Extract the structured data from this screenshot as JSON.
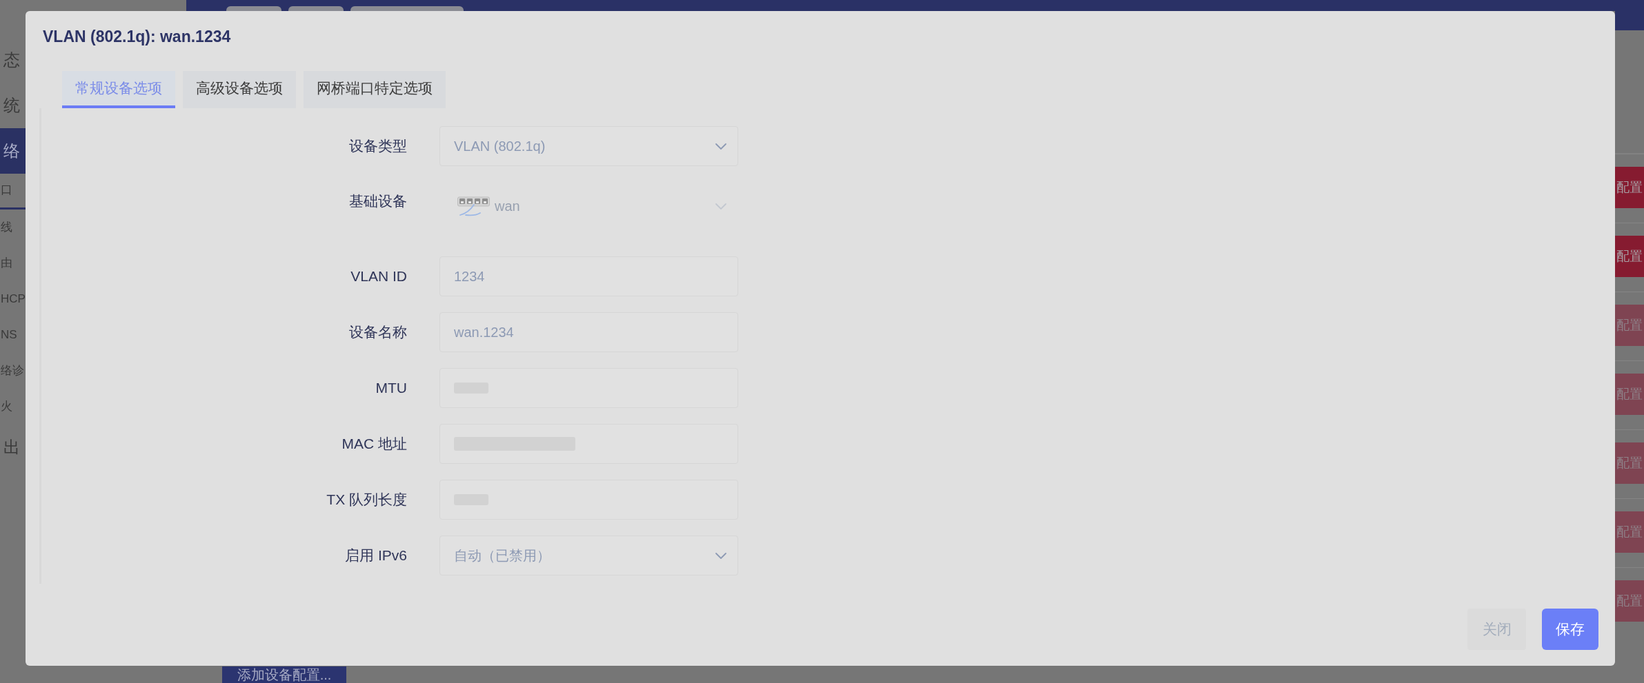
{
  "page": {
    "sidebar": {
      "items": [
        {
          "label": "态",
          "kind": "top",
          "selected": false
        },
        {
          "label": "统",
          "kind": "top",
          "selected": false
        },
        {
          "label": "络",
          "kind": "top",
          "selected": true
        },
        {
          "label": "口",
          "kind": "sub",
          "selected": true
        },
        {
          "label": "线",
          "kind": "sub",
          "selected": false
        },
        {
          "label": "由",
          "kind": "sub",
          "selected": false
        },
        {
          "label": "HCP",
          "kind": "sub",
          "selected": false
        },
        {
          "label": "NS",
          "kind": "sub",
          "selected": false
        },
        {
          "label": "络诊",
          "kind": "sub",
          "selected": false
        },
        {
          "label": "火",
          "kind": "sub",
          "selected": false
        },
        {
          "label": "出",
          "kind": "top",
          "selected": false
        }
      ]
    },
    "device_rows": [
      {
        "action": "配置",
        "disabled": false
      },
      {
        "action": "配置",
        "disabled": false
      },
      {
        "action": "配置",
        "disabled": true
      },
      {
        "action": "配置",
        "disabled": true
      },
      {
        "action": "配置",
        "disabled": true
      },
      {
        "action": "配置",
        "disabled": true
      },
      {
        "action": "配置",
        "disabled": true
      }
    ],
    "add_button": "添加设备配置..."
  },
  "dialog": {
    "title": "VLAN (802.1q): wan.1234",
    "tabs": [
      {
        "label": "常规设备选项",
        "selected": true
      },
      {
        "label": "高级设备选项",
        "selected": false
      },
      {
        "label": "网桥端口特定选项",
        "selected": false
      }
    ],
    "fields": [
      {
        "label": "设备类型",
        "kind": "select",
        "value": "VLAN (802.1q)",
        "disabled": false,
        "redacted": false
      },
      {
        "label": "基础设备",
        "kind": "device-select",
        "value": "wan",
        "disabled": true,
        "redacted": false
      },
      {
        "label": "VLAN ID",
        "kind": "text",
        "value": "1234",
        "disabled": false,
        "redacted": false
      },
      {
        "label": "设备名称",
        "kind": "text",
        "value": "wan.1234",
        "disabled": false,
        "redacted": false
      },
      {
        "label": "MTU",
        "kind": "text",
        "disabled": false,
        "redacted": true
      },
      {
        "label": "MAC 地址",
        "kind": "address",
        "disabled": false,
        "redacted": true
      },
      {
        "label": "TX 队列长度",
        "kind": "text",
        "disabled": false,
        "redacted": true
      },
      {
        "label": "启用 IPv6",
        "kind": "select",
        "value": "自动（已禁用）",
        "disabled": false,
        "redacted": false
      }
    ],
    "buttons": [
      {
        "label": "关闭",
        "kind": "secondary"
      },
      {
        "label": "保存",
        "kind": "primary"
      }
    ]
  }
}
